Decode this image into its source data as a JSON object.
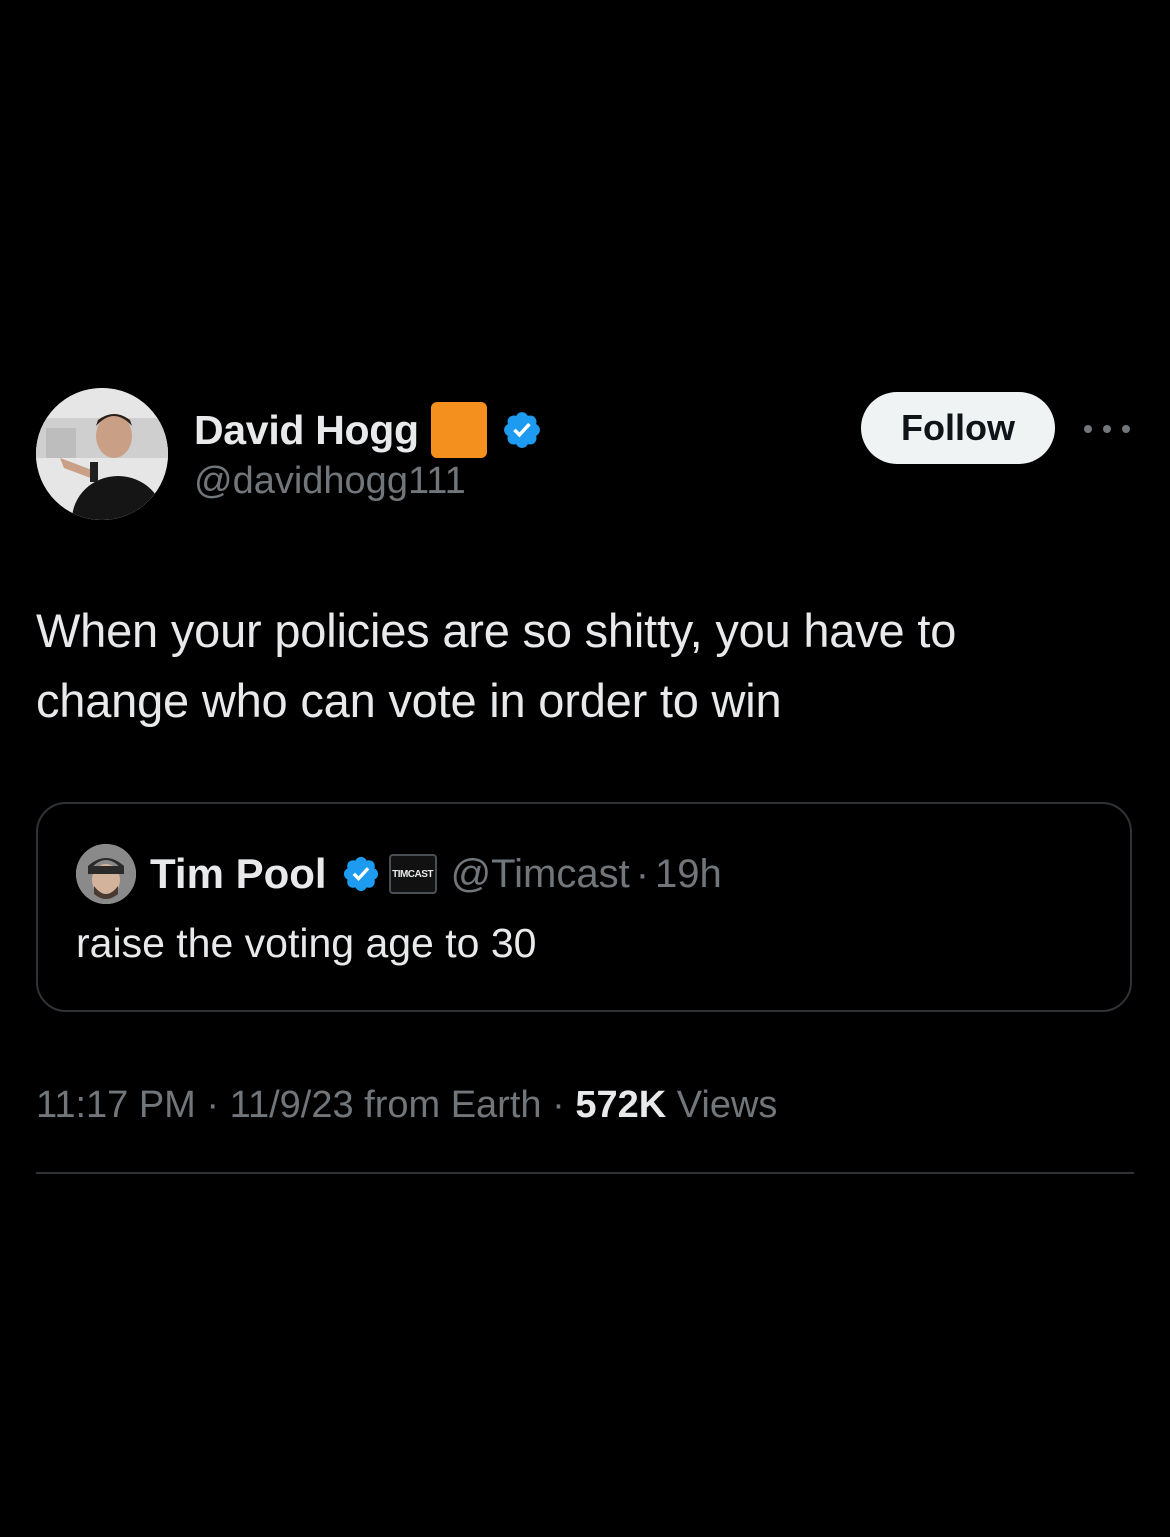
{
  "tweet": {
    "author": {
      "display_name": "David Hogg",
      "handle": "@davidhogg111",
      "flag_emoji_color": "#f4901e",
      "verified_icon": "verified-badge-icon",
      "verified_color": "#1d9bf0"
    },
    "follow_label": "Follow",
    "more_icon": "more-horizontal-icon",
    "text_lines": [
      "When your policies are so shitty, you have to",
      "change who can vote in order to win"
    ],
    "quote": {
      "display_name": "Tim Pool",
      "affiliate_badge": "TIMCAST",
      "handle": "@Timcast",
      "separator": "·",
      "time": "19h",
      "text": "raise the voting age to 30"
    },
    "meta": {
      "time": "11:17 PM",
      "separator": "·",
      "date_source": "11/9/23 from Earth",
      "views_count": "572K",
      "views_label": "Views"
    }
  },
  "colors": {
    "background": "#000000",
    "primary_text": "#e7e9ea",
    "secondary_text": "#71767b",
    "border": "#2f3336",
    "follow_bg": "#eff3f4"
  }
}
